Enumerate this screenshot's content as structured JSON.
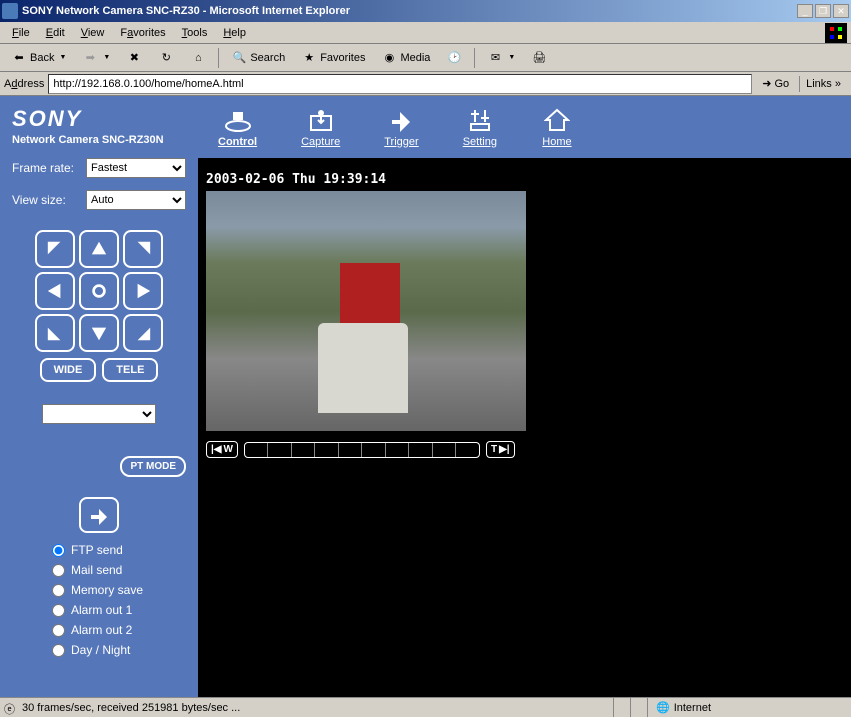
{
  "window": {
    "title": "SONY Network Camera SNC-RZ30 - Microsoft Internet Explorer"
  },
  "menubar": {
    "file": "File",
    "edit": "Edit",
    "view": "View",
    "favorites": "Favorites",
    "tools": "Tools",
    "help": "Help"
  },
  "toolbar": {
    "back": "Back",
    "search": "Search",
    "favorites": "Favorites",
    "media": "Media"
  },
  "address": {
    "label": "Address",
    "url": "http://192.168.0.100/home/homeA.html",
    "go": "Go",
    "links": "Links"
  },
  "brand": {
    "logo": "SONY",
    "product": "Network Camera SNC-RZ30N"
  },
  "navtabs": {
    "control": "Control",
    "capture": "Capture",
    "trigger": "Trigger",
    "setting": "Setting",
    "home": "Home"
  },
  "sidebar": {
    "framerate_label": "Frame rate:",
    "framerate_value": "Fastest",
    "viewsize_label": "View size:",
    "viewsize_value": "Auto",
    "wide": "WIDE",
    "tele": "TELE",
    "ptmode": "PT MODE",
    "radios": {
      "ftp": "FTP send",
      "mail": "Mail send",
      "memory": "Memory save",
      "alarm1": "Alarm out 1",
      "alarm2": "Alarm out 2",
      "daynight": "Day / Night"
    }
  },
  "video": {
    "timestamp": "2003-02-06 Thu 19:39:14",
    "wide_end": "W",
    "tele_end": "T"
  },
  "statusbar": {
    "text": "30 frames/sec, received 251981 bytes/sec ...",
    "zone": "Internet"
  }
}
